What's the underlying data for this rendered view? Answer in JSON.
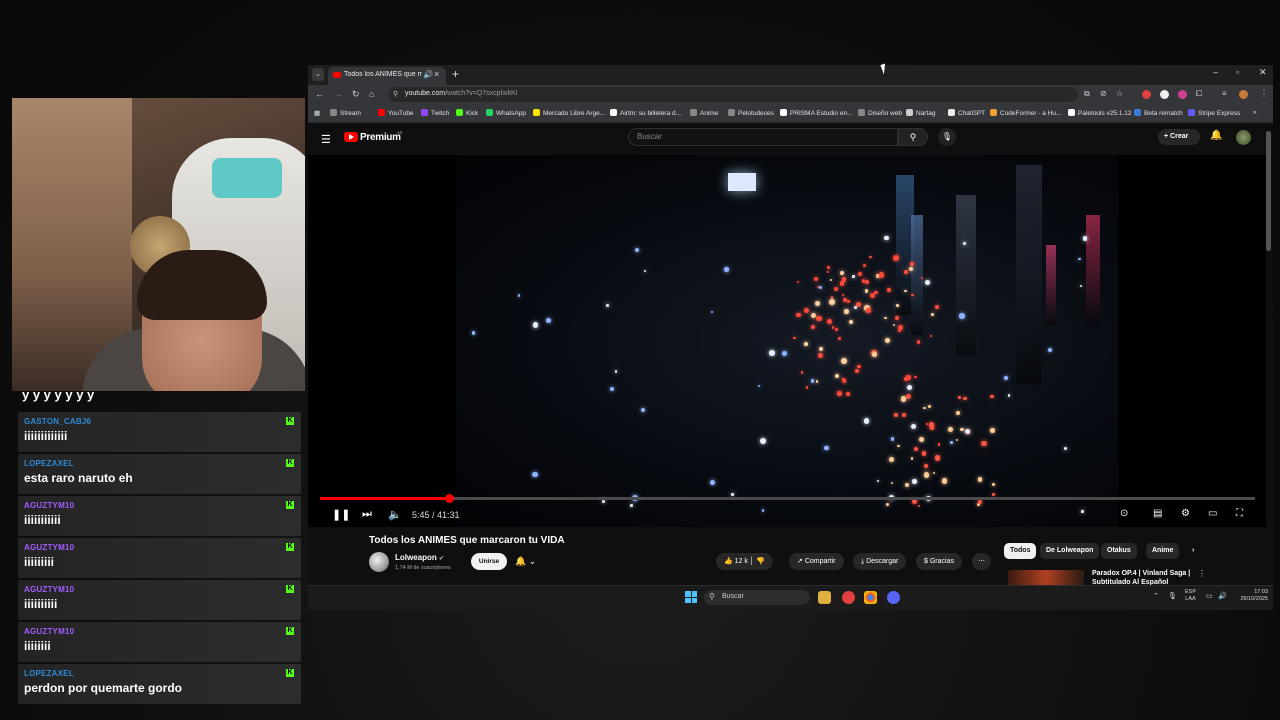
{
  "chat": {
    "messages": [
      {
        "user": "GASTON_CABJ6",
        "text": "iiiiiiiiiiiii",
        "color": "#2e8bd6"
      },
      {
        "user": "LOPEZAXEL",
        "text": "esta raro naruto eh",
        "color": "#2e8bd6"
      },
      {
        "user": "AGUZTYM10",
        "text": "iiiiiiiiiii",
        "color": "#a35cff"
      },
      {
        "user": "AGUZTYM10",
        "text": "iiiiiiiii",
        "color": "#a35cff"
      },
      {
        "user": "AGUZTYM10",
        "text": "iiiiiiiiii",
        "color": "#a35cff"
      },
      {
        "user": "AGUZTYM10",
        "text": "iiiiiiii",
        "color": "#a35cff"
      },
      {
        "user": "LOPEZAXEL",
        "text": "perdon por quemarte gordo",
        "color": "#2e8bd6"
      }
    ],
    "partial_text": "y y y y y y y",
    "platform_icon": "kick-icon"
  },
  "browser": {
    "tab_title": "Todos los ANIMES que mar...",
    "url_host": "youtube.com",
    "url_path": "/watch?v=Q7sxcpIwkKI",
    "bookmarks": [
      "Stream",
      "YouTube",
      "Twitch",
      "Kick",
      "WhatsApp",
      "Mercado Libre Arge...",
      "Airtm: su billetera d...",
      "Anime",
      "Pelotudeces",
      "PRISMA Estudio en...",
      "Diseño web",
      "Nartag",
      "ChatGPT",
      "CodeFormer - a Hu...",
      "Paletools v25.1.12",
      "Beta rematch",
      "Stripe Express"
    ]
  },
  "youtube": {
    "brand": "Premium",
    "region": "AR",
    "search_placeholder": "Buscar",
    "create_label": "Crear",
    "video_time": "5:45 / 41:31",
    "progress": 0.1385,
    "video_title": "Todos los ANIMES que marcaron tu VIDA",
    "channel": "Lolweapon",
    "subscribers": "1,74 M de suscriptores",
    "join_label": "Unirse",
    "likes": "12 k",
    "share_label": "Compartir",
    "download_label": "Descargar",
    "thanks_label": "Gracias",
    "chips": [
      "Todos",
      "De Lolweapon",
      "Otakus",
      "Anime"
    ],
    "related_title": "Paradox OP.4 | Vinland Saga | Subtitulado Al Español"
  },
  "taskbar": {
    "search_placeholder": "Buscar",
    "lang": "ESP",
    "lang_sub": "LAA",
    "time": "17:03",
    "date": "26/10/2025"
  }
}
